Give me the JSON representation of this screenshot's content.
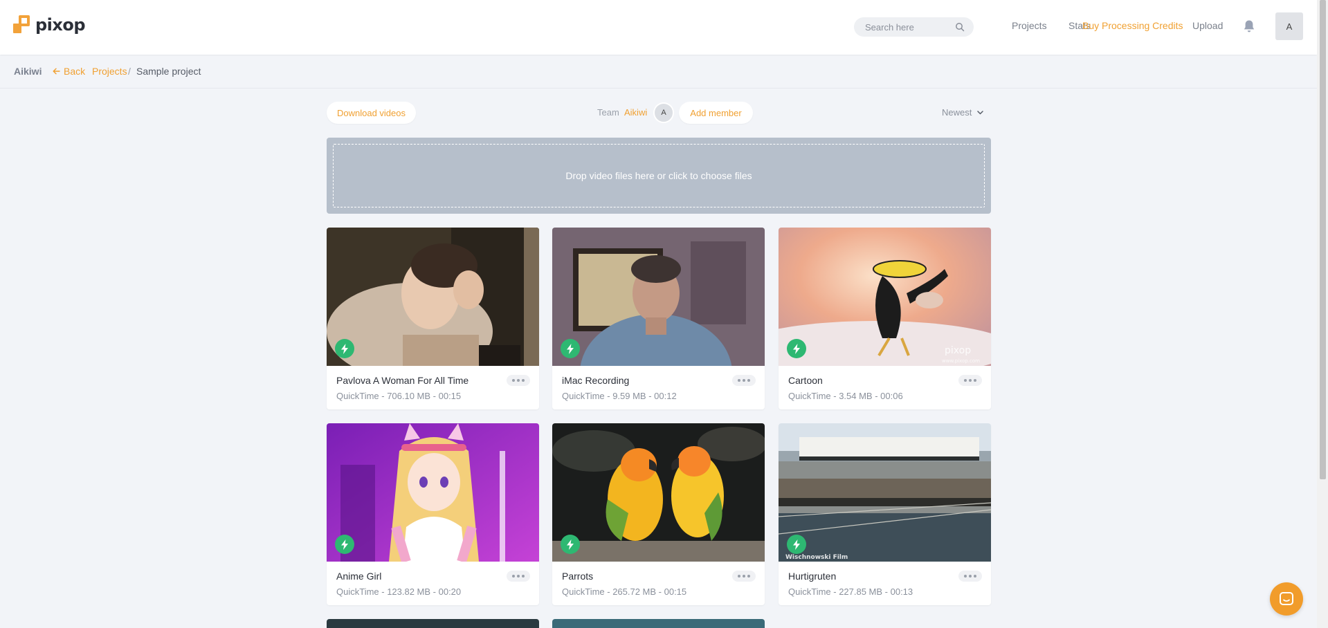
{
  "brand": {
    "logo_text": "pixop",
    "accent_color": "#f0a031",
    "bolt_color": "#2eb872"
  },
  "topnav": {
    "search_placeholder": "Search here",
    "links": [
      "Projects",
      "Stats",
      "Buy Processing Credits",
      "Upload"
    ],
    "avatar_initial": "A"
  },
  "breadcrumb": {
    "team": "Aikiwi",
    "back_label": "Back",
    "projects_label": "Projects",
    "separator": "/",
    "current": "Sample project"
  },
  "toolbar": {
    "download_label": "Download videos",
    "team_label": "Team",
    "team_name": "Aikiwi",
    "member_initial": "A",
    "add_member_label": "Add member",
    "sort_label": "Newest"
  },
  "dropzone": {
    "text": "Drop video files here or click to choose files"
  },
  "videos": [
    {
      "title": "Pavlova A Woman For All Time",
      "meta": "QuickTime - 706.10 MB - 00:15"
    },
    {
      "title": "iMac Recording",
      "meta": "QuickTime - 9.59 MB - 00:12"
    },
    {
      "title": "Cartoon",
      "meta": "QuickTime - 3.54 MB - 00:06"
    },
    {
      "title": "Anime Girl",
      "meta": "QuickTime - 123.82 MB - 00:20"
    },
    {
      "title": "Parrots",
      "meta": "QuickTime - 265.72 MB - 00:15"
    },
    {
      "title": "Hurtigruten",
      "meta": "QuickTime - 227.85 MB - 00:13"
    }
  ],
  "thumb_overlays": {
    "cartoon_watermark_logo": "pixop",
    "cartoon_watermark_url": "www.pixop.com",
    "hurtigruten_credit": "Wischnowski Film"
  }
}
